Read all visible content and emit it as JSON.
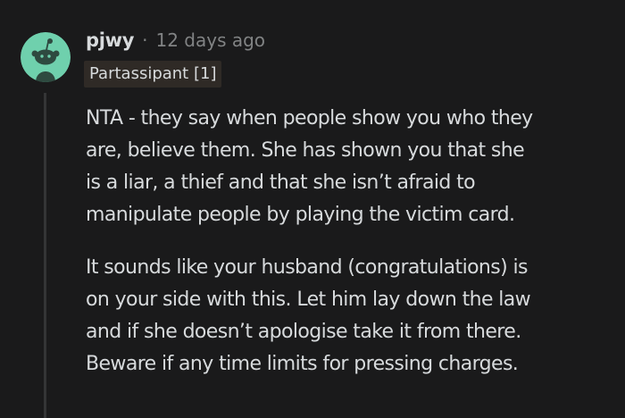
{
  "comment": {
    "username": "pjwy",
    "separator": "·",
    "timestamp": "12 days ago",
    "flair": "Partassipant [1]",
    "paragraphs": [
      {
        "lines": [
          "NTA - they say when people show you who they",
          "are, believe them. She has shown you that she",
          "is a liar, a thief and that she isn’t afraid to",
          "manipulate people by playing the victim card."
        ]
      },
      {
        "lines": [
          "It sounds like your husband (congratulations) is",
          "on your side with this. Let him lay down the law",
          "and if she doesn’t apologise take it from there.",
          "Beware if any time limits for pressing charges."
        ]
      }
    ]
  },
  "colors": {
    "background": "#1a1a1b",
    "avatar_bg": "#6fd0ad",
    "avatar_figure": "#2e4a40",
    "text": "#d7dadc",
    "meta": "#818384",
    "flair_bg": "#2f2a26",
    "thread_line": "#343536"
  }
}
